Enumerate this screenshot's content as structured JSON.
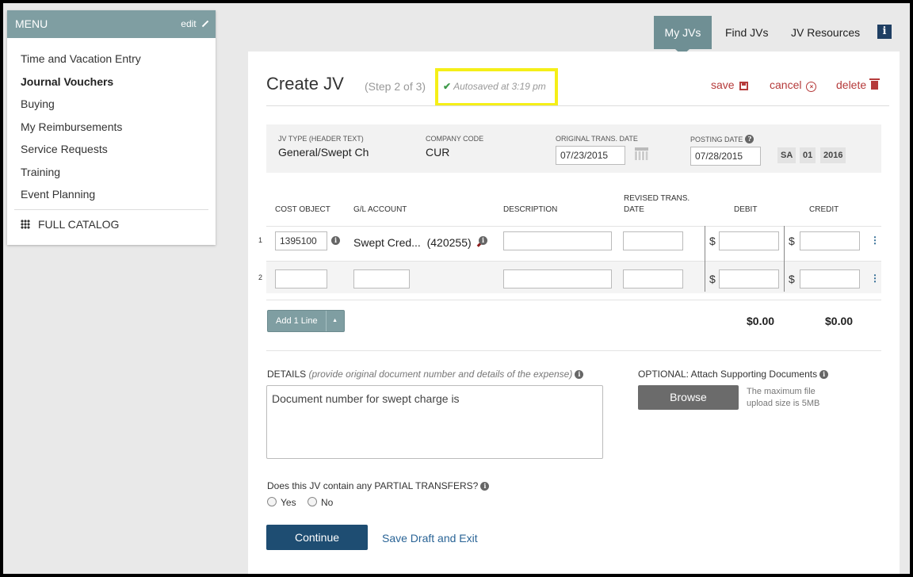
{
  "menu": {
    "title": "MENU",
    "edit_label": "edit",
    "items": [
      {
        "label": "Time and Vacation Entry"
      },
      {
        "label": "Journal Vouchers"
      },
      {
        "label": "Buying"
      },
      {
        "label": "My Reimbursements"
      },
      {
        "label": "Service Requests"
      },
      {
        "label": "Training"
      },
      {
        "label": "Event Planning"
      }
    ],
    "catalog_label": "FULL CATALOG"
  },
  "nav": {
    "tabs": [
      {
        "label": "My JVs"
      },
      {
        "label": "Find JVs"
      },
      {
        "label": "JV Resources"
      }
    ],
    "info_label": "i"
  },
  "header": {
    "title": "Create JV",
    "step": "(Step 2 of 3)",
    "autosave": "Autosaved at 3:19 pm",
    "save_label": "save",
    "cancel_label": "cancel",
    "delete_label": "delete"
  },
  "meta": {
    "jv_type_label": "JV TYPE (HEADER TEXT)",
    "jv_type_value": "General/Swept Ch",
    "company_code_label": "COMPANY CODE",
    "company_code_value": "CUR",
    "orig_date_label": "ORIGINAL TRANS. DATE",
    "orig_date_value": "07/23/2015",
    "posting_date_label": "POSTING DATE",
    "posting_date_value": "07/28/2015",
    "period_code": "SA",
    "period_month": "01",
    "period_year": "2016"
  },
  "table": {
    "headers": {
      "cost_object": "COST OBJECT",
      "gl_account": "G/L ACCOUNT",
      "description": "DESCRIPTION",
      "revised_date_1": "REVISED TRANS.",
      "revised_date_2": "DATE",
      "debit": "DEBIT",
      "credit": "CREDIT"
    },
    "rows": [
      {
        "num": "1",
        "cost_object": "1395100",
        "gl_account_name": "Swept Cred...",
        "gl_account_code": "(420255)"
      },
      {
        "num": "2",
        "cost_object": "",
        "gl_account_name": "",
        "gl_account_code": ""
      }
    ],
    "currency_symbol": "$",
    "add_line_label": "Add 1 Line",
    "total_debit": "$0.00",
    "total_credit": "$0.00"
  },
  "details": {
    "label": "DETAILS",
    "hint": "(provide original document number and details of the expense)",
    "value": "Document number for swept charge is"
  },
  "attach": {
    "label": "OPTIONAL: Attach Supporting Documents",
    "browse_label": "Browse",
    "max_size_text": "The maximum file upload size is 5MB"
  },
  "partial": {
    "question": "Does this JV contain any PARTIAL TRANSFERS?",
    "yes_label": "Yes",
    "no_label": "No"
  },
  "footer": {
    "continue_label": "Continue",
    "save_draft_label": "Save Draft and Exit"
  },
  "colors": {
    "menu_header": "#7f9ea2",
    "active_tab": "#6f8f94",
    "action_red": "#b53a3a",
    "primary_button": "#1e4d72",
    "autosave_highlight": "#f5ef17"
  }
}
